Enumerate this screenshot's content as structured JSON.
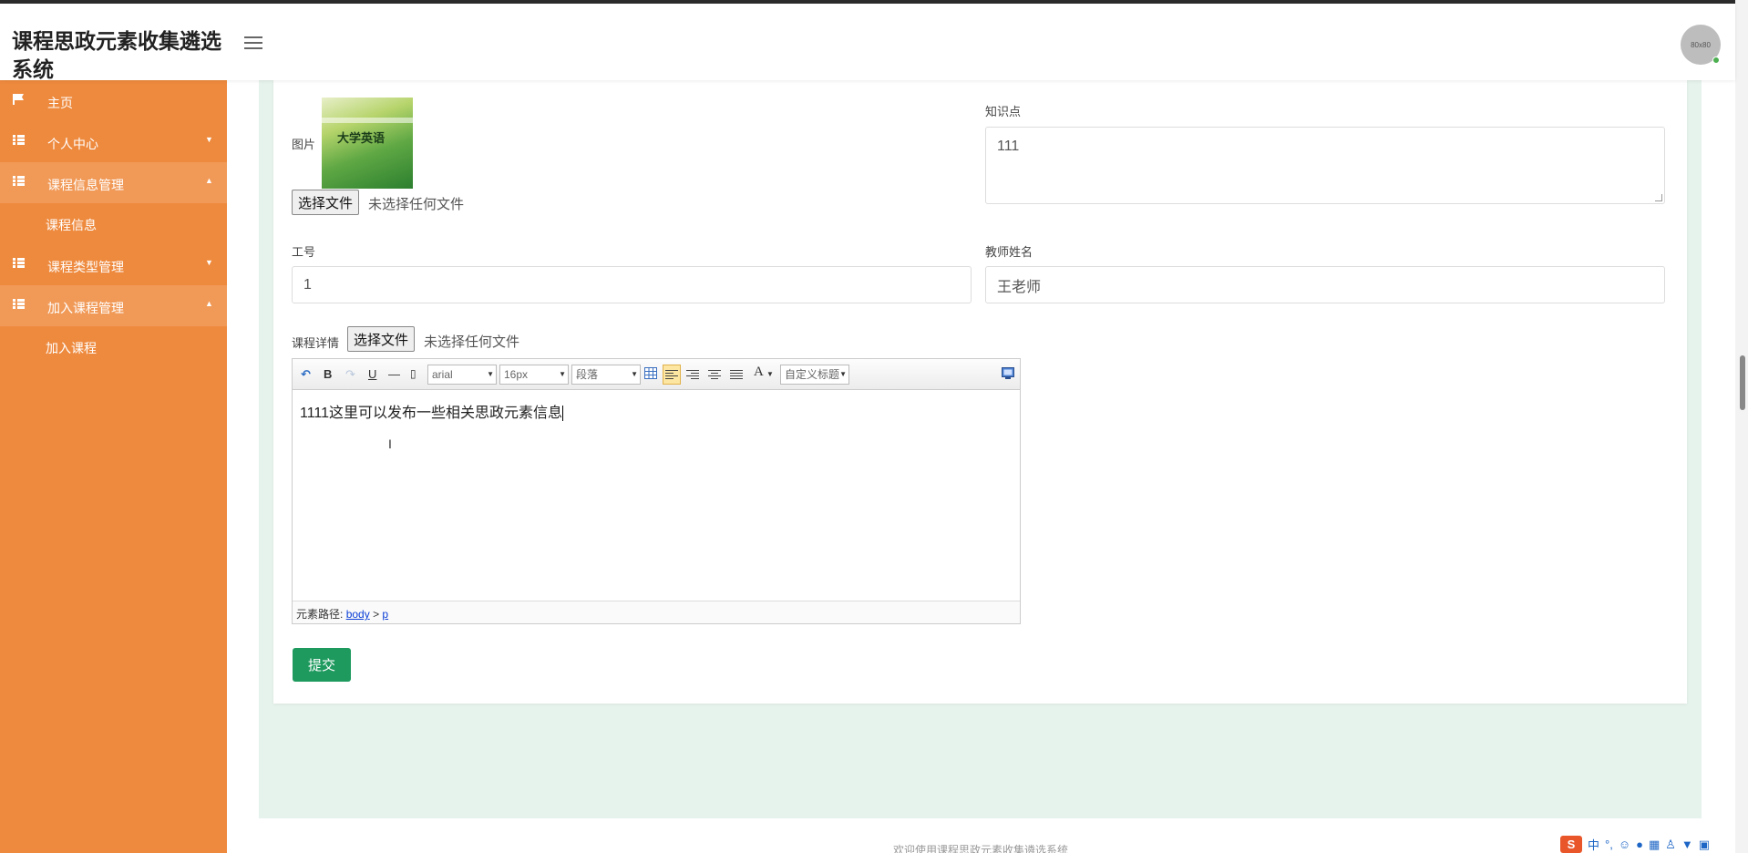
{
  "app": {
    "title": "课程思政元素收集遴选系统",
    "avatar_text": "80x80"
  },
  "sidebar": {
    "items": [
      {
        "label": "主页",
        "icon": "flag-icon",
        "expanded": false
      },
      {
        "label": "个人中心",
        "icon": "grid-icon",
        "expanded": false
      },
      {
        "label": "课程信息管理",
        "icon": "grid-icon",
        "expanded": true,
        "children": [
          "课程信息"
        ]
      },
      {
        "label": "课程类型管理",
        "icon": "grid-icon",
        "expanded": false
      },
      {
        "label": "加入课程管理",
        "icon": "grid-icon",
        "expanded": true,
        "children": [
          "加入课程"
        ]
      }
    ]
  },
  "form": {
    "image_label": "图片",
    "thumb_title": "大学英语",
    "file_button": "选择文件",
    "no_file_text": "未选择任何文件",
    "knowledge_label": "知识点",
    "knowledge_value": "111",
    "id_label": "工号",
    "id_value": "1",
    "teacher_label": "教师姓名",
    "teacher_value": "王老师",
    "detail_label": "课程详情",
    "submit_label": "提交"
  },
  "editor": {
    "font_family": "arial",
    "font_size": "16px",
    "paragraph": "段落",
    "custom_title": "自定义标题",
    "content": "1111这里可以发布一些相关思政元素信息",
    "path_label": "元素路径:",
    "path_body": "body",
    "path_sep": ">",
    "path_p": "p"
  },
  "footer": {
    "text": "欢迎使用课程思政元素收集遴选系统"
  },
  "ime": {
    "logo": "S",
    "mode": "中"
  },
  "colors": {
    "sidebar": "#ee8a3e",
    "submit": "#1e9a5e",
    "content_bg": "#e6f2ec"
  }
}
